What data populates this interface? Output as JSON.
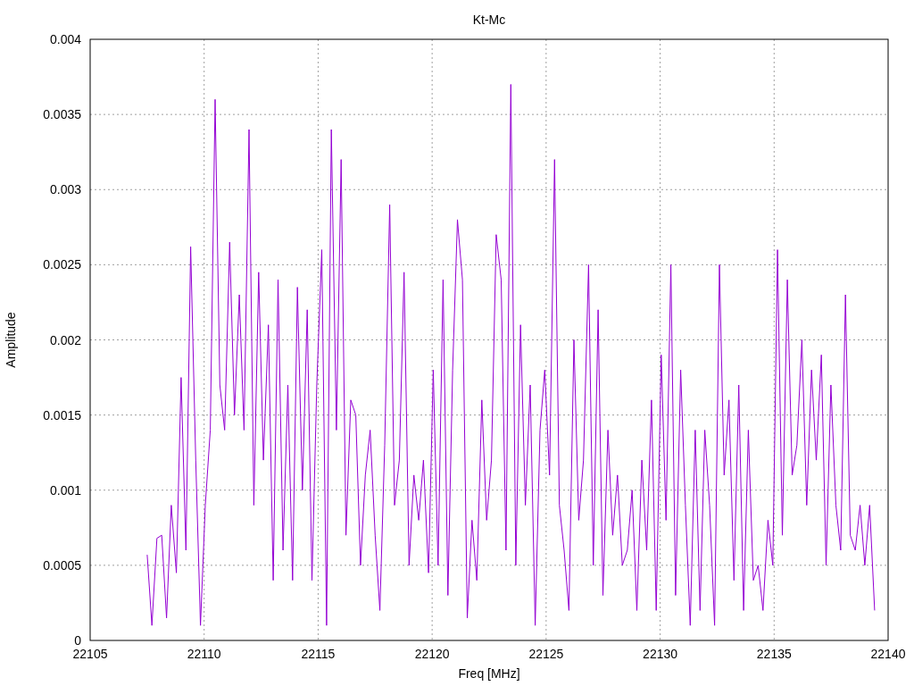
{
  "chart": {
    "chart_data": {
      "type": "line",
      "title": "Kt-Mc",
      "xlabel": "Freq [MHz]",
      "ylabel": "Amplitude",
      "xlim": [
        22105,
        22140
      ],
      "grid": true,
      "ylim": [
        0,
        0.004
      ],
      "xticks": [
        22105,
        22110,
        22115,
        22120,
        22125,
        22130,
        22135,
        22140
      ],
      "yticks": [
        0,
        0.0005,
        0.001,
        0.0015,
        0.002,
        0.0025,
        0.003,
        0.0035,
        0.004
      ],
      "x": [
        22107.5,
        22107.71,
        22107.93,
        22108.14,
        22108.35,
        22108.56,
        22108.78,
        22108.99,
        22109.2,
        22109.41,
        22109.63,
        22109.84,
        22110.05,
        22110.27,
        22110.48,
        22110.69,
        22110.9,
        22111.12,
        22111.33,
        22111.54,
        22111.75,
        22111.97,
        22112.18,
        22112.39,
        22112.6,
        22112.82,
        22113.03,
        22113.24,
        22113.46,
        22113.67,
        22113.88,
        22114.09,
        22114.31,
        22114.52,
        22114.73,
        22114.94,
        22115.16,
        22115.37,
        22115.58,
        22115.8,
        22116.01,
        22116.22,
        22116.43,
        22116.65,
        22116.86,
        22117.07,
        22117.28,
        22117.5,
        22117.71,
        22117.92,
        22118.14,
        22118.35,
        22118.56,
        22118.77,
        22118.99,
        22119.2,
        22119.41,
        22119.62,
        22119.84,
        22120.05,
        22120.26,
        22120.48,
        22120.69,
        22120.9,
        22121.11,
        22121.33,
        22121.54,
        22121.75,
        22121.96,
        22122.18,
        22122.39,
        22122.6,
        22122.81,
        22123.03,
        22123.24,
        22123.45,
        22123.67,
        22123.88,
        22124.09,
        22124.3,
        22124.52,
        22124.73,
        22124.94,
        22125.15,
        22125.37,
        22125.58,
        22125.79,
        22126.0,
        22126.22,
        22126.43,
        22126.64,
        22126.86,
        22127.07,
        22127.28,
        22127.49,
        22127.71,
        22127.92,
        22128.13,
        22128.34,
        22128.56,
        22128.77,
        22128.98,
        22129.2,
        22129.41,
        22129.62,
        22129.83,
        22130.05,
        22130.26,
        22130.47,
        22130.68,
        22130.9,
        22131.11,
        22131.32,
        22131.54,
        22131.75,
        22131.96,
        22132.17,
        22132.39,
        22132.6,
        22132.81,
        22133.02,
        22133.24,
        22133.45,
        22133.66,
        22133.87,
        22134.09,
        22134.3,
        22134.51,
        22134.73,
        22134.94,
        22135.15,
        22135.36,
        22135.58,
        22135.79,
        22136.0,
        22136.22,
        22136.43,
        22136.64,
        22136.85,
        22137.07,
        22137.28,
        22137.49,
        22137.71,
        22137.92,
        22138.13,
        22138.34,
        22138.56,
        22138.77,
        22138.98,
        22139.19,
        22139.41
      ],
      "series": [
        {
          "color": "#9400d3",
          "values": [
            0.00057,
            0.0001,
            0.00068,
            0.0007,
            0.00015,
            0.0009,
            0.00045,
            0.00175,
            0.0006,
            0.00262,
            0.0012,
            0.0001,
            0.0009,
            0.0014,
            0.0036,
            0.0017,
            0.0014,
            0.00265,
            0.0015,
            0.0023,
            0.0014,
            0.0034,
            0.0009,
            0.00245,
            0.0012,
            0.0021,
            0.0004,
            0.0024,
            0.0006,
            0.0017,
            0.0004,
            0.00235,
            0.001,
            0.0022,
            0.0004,
            0.0017,
            0.0026,
            0.0001,
            0.0034,
            0.0014,
            0.0032,
            0.0007,
            0.0016,
            0.0015,
            0.0005,
            0.0011,
            0.0014,
            0.0007,
            0.0002,
            0.0013,
            0.0029,
            0.0009,
            0.0012,
            0.00245,
            0.0005,
            0.0011,
            0.0008,
            0.0012,
            0.00045,
            0.0018,
            0.0005,
            0.0024,
            0.0003,
            0.0018,
            0.0028,
            0.0024,
            0.00015,
            0.0008,
            0.0004,
            0.0016,
            0.0008,
            0.0012,
            0.0027,
            0.0024,
            0.0006,
            0.0037,
            0.0005,
            0.0021,
            0.0009,
            0.0017,
            0.0001,
            0.0014,
            0.0018,
            0.0011,
            0.0032,
            0.0009,
            0.0006,
            0.0002,
            0.002,
            0.0008,
            0.0012,
            0.0025,
            0.0005,
            0.0022,
            0.0003,
            0.0014,
            0.0007,
            0.0011,
            0.0005,
            0.0006,
            0.001,
            0.0002,
            0.0012,
            0.0006,
            0.0016,
            0.0002,
            0.0019,
            0.0008,
            0.0025,
            0.0003,
            0.0018,
            0.0009,
            0.0001,
            0.0014,
            0.0002,
            0.0014,
            0.0009,
            0.0001,
            0.0025,
            0.0011,
            0.0016,
            0.0004,
            0.0017,
            0.0002,
            0.0014,
            0.0004,
            0.0005,
            0.0002,
            0.0008,
            0.0005,
            0.0026,
            0.0007,
            0.0024,
            0.0011,
            0.0013,
            0.002,
            0.0009,
            0.0018,
            0.0012,
            0.0019,
            0.0005,
            0.0017,
            0.0009,
            0.0006,
            0.0023,
            0.0007,
            0.0006,
            0.0009,
            0.0005,
            0.0009,
            0.0002
          ]
        }
      ]
    }
  }
}
